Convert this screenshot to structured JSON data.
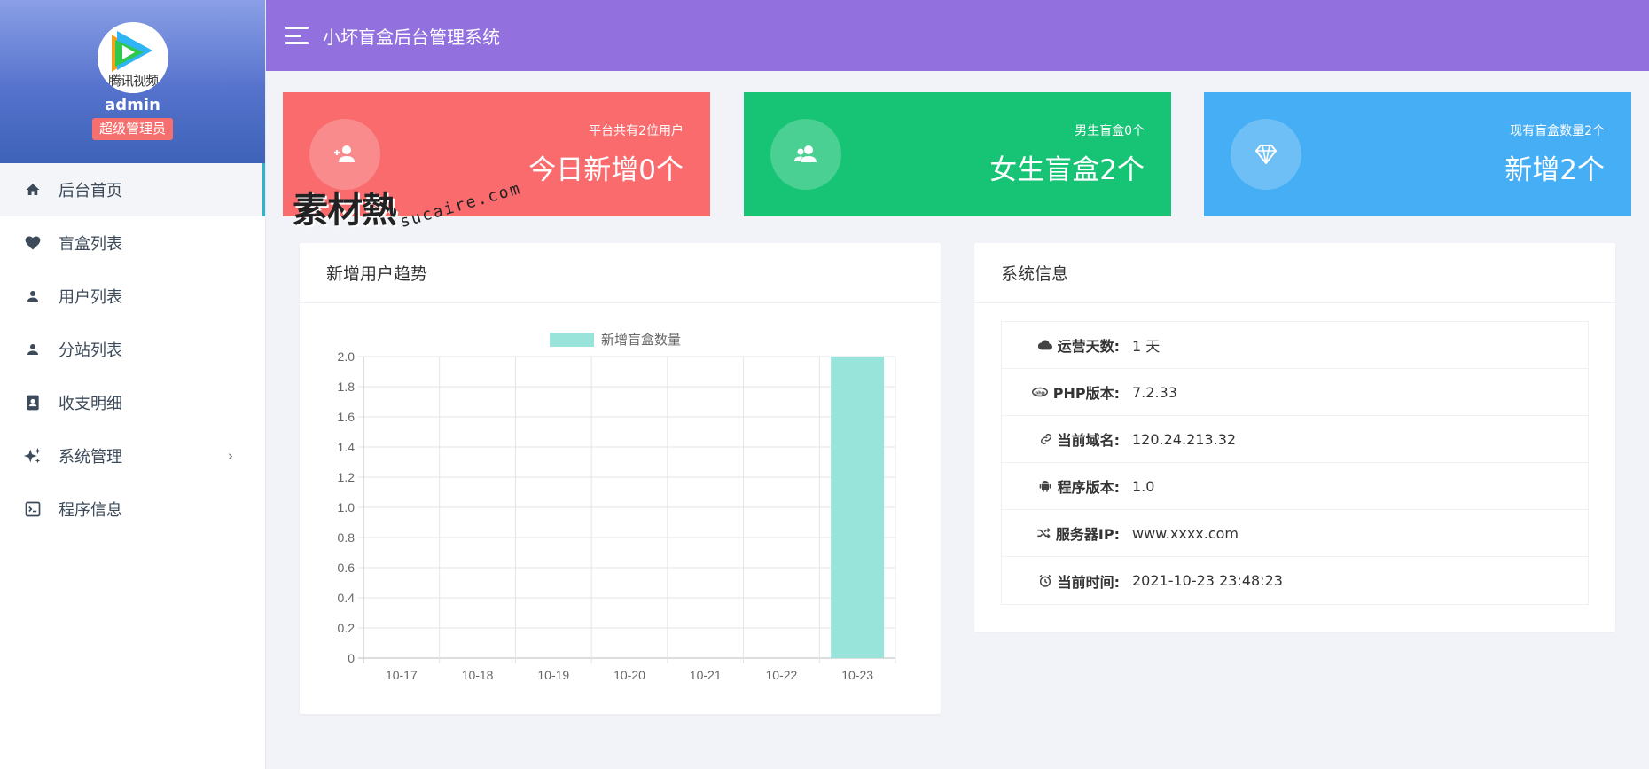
{
  "app": {
    "title": "小坏盲盒后台管理系统"
  },
  "user": {
    "name": "admin",
    "role": "超级管理员",
    "avatar_text": "腾讯视频"
  },
  "sidebar": {
    "items": [
      {
        "label": "后台首页",
        "icon": "home-icon"
      },
      {
        "label": "盲盒列表",
        "icon": "heart-icon"
      },
      {
        "label": "用户列表",
        "icon": "user-icon"
      },
      {
        "label": "分站列表",
        "icon": "user-icon"
      },
      {
        "label": "收支明细",
        "icon": "contact-book-icon"
      },
      {
        "label": "系统管理",
        "icon": "sparkle-icon",
        "chevron": "›"
      },
      {
        "label": "程序信息",
        "icon": "terminal-icon"
      }
    ]
  },
  "stats": [
    {
      "small": "平台共有2位用户",
      "big": "今日新增0个",
      "color": "#f96b6d",
      "icon": "user-add-icon"
    },
    {
      "small": "男生盲盒0个",
      "big": "女生盲盒2个",
      "color": "#17c374",
      "icon": "users-icon"
    },
    {
      "small": "现有盲盒数量2个",
      "big": "新增2个",
      "color": "#46aef4",
      "icon": "diamond-icon"
    }
  ],
  "watermark": {
    "logo": "素材熱",
    "url": "sucaire.com"
  },
  "chart_panel": {
    "title": "新增用户趋势"
  },
  "chart_data": {
    "type": "bar",
    "categories": [
      "10-17",
      "10-18",
      "10-19",
      "10-20",
      "10-21",
      "10-22",
      "10-23"
    ],
    "series": [
      {
        "name": "新增盲盒数量",
        "values": [
          0,
          0,
          0,
          0,
          0,
          0,
          2
        ],
        "color": "#98e3da"
      }
    ],
    "ylim": [
      0,
      2.0
    ],
    "yticks": [
      "0",
      "0.2",
      "0.4",
      "0.6",
      "0.8",
      "1.0",
      "1.2",
      "1.4",
      "1.6",
      "1.8",
      "2.0"
    ],
    "grid": true,
    "legend": "top-center"
  },
  "info_panel": {
    "title": "系统信息",
    "rows": [
      {
        "key": "运营天数:",
        "value": "1 天",
        "icon": "cloud-icon"
      },
      {
        "key": "PHP版本:",
        "value": "7.2.33",
        "icon": "php-icon"
      },
      {
        "key": "当前域名:",
        "value": "120.24.213.32",
        "icon": "link-icon"
      },
      {
        "key": "程序版本:",
        "value": "1.0",
        "icon": "android-icon"
      },
      {
        "key": "服务器IP:",
        "value": "www.xxxx.com",
        "icon": "shuffle-icon"
      },
      {
        "key": "当前时间:",
        "value": "2021-10-23 23:48:23",
        "icon": "alarm-icon"
      }
    ]
  }
}
